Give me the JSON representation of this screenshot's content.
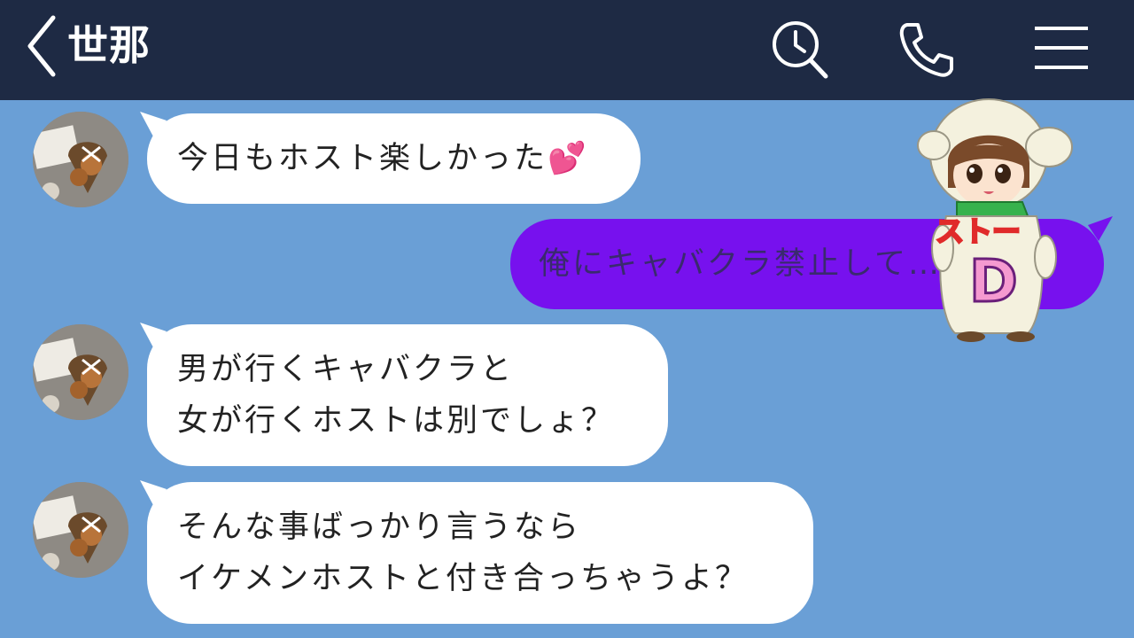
{
  "header": {
    "title": "世那",
    "icons": [
      "back-chevron-icon",
      "search-clock-icon",
      "phone-icon",
      "menu-icon"
    ]
  },
  "colors": {
    "header_bg": "#1e2a44",
    "chat_bg": "#6a9fd6",
    "received_bubble": "#ffffff",
    "sent_bubble": "#7711ee"
  },
  "messages": [
    {
      "from": "other",
      "lines": [
        "今日もホスト楽しかった💕"
      ]
    },
    {
      "from": "me",
      "lines": [
        "俺にキャバクラ禁止して…？"
      ]
    },
    {
      "from": "other",
      "lines": [
        "男が行くキャバクラと",
        "女が行くホストは別でしょ？"
      ]
    },
    {
      "from": "other",
      "lines": [
        "そんな事ばっかり言うなら",
        "イケメンホストと付き合っちゃうよ？"
      ]
    }
  ],
  "sticker": {
    "text_top": "ストー",
    "text_big": "D"
  }
}
